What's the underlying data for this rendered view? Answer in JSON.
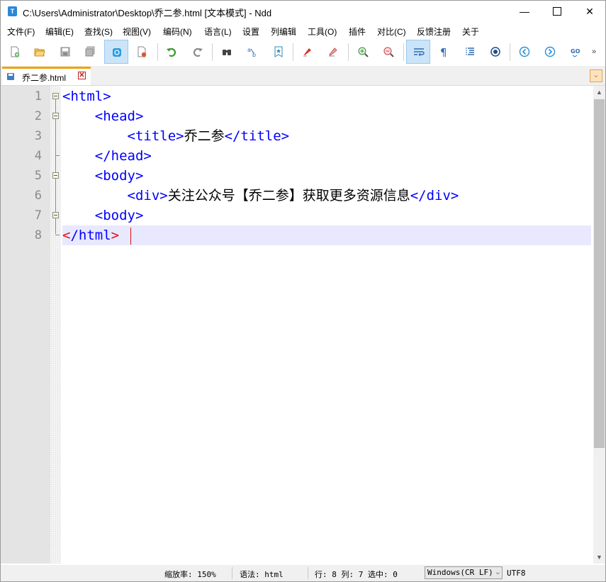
{
  "window": {
    "title": "C:\\Users\\Administrator\\Desktop\\乔二参.html [文本模式] - Ndd",
    "app_icon_letter": "T",
    "minimize": "—",
    "close": "✕"
  },
  "menu": [
    "文件(F)",
    "编辑(E)",
    "查找(S)",
    "视图(V)",
    "编码(N)",
    "语言(L)",
    "设置",
    "列编辑",
    "工具(O)",
    "插件",
    "对比(C)",
    "反馈注册",
    "关于"
  ],
  "toolbar": {
    "overflow": "»",
    "buttons": [
      "new-file-icon",
      "open-file-icon",
      "save-icon",
      "save-all-icon",
      "file-monitor-icon",
      "close-file-icon",
      "undo-icon",
      "redo-icon",
      "find-icon",
      "replace-icon",
      "bookmark-icon",
      "mark-icon",
      "clear-mark-icon",
      "zoom-in-icon",
      "zoom-out-icon",
      "word-wrap-icon",
      "show-symbols-icon",
      "indent-guide-icon",
      "macro-icon",
      "prev-icon",
      "next-icon",
      "goto-line-icon"
    ]
  },
  "tab": {
    "label": "乔二参.html",
    "close": "✕",
    "dropdown": "⌄"
  },
  "editor": {
    "line_numbers": [
      "1",
      "2",
      "3",
      "4",
      "5",
      "6",
      "7",
      "8"
    ],
    "lines": [
      {
        "indent": "",
        "parts": [
          [
            "tag",
            "<html>"
          ]
        ]
      },
      {
        "indent": "    ",
        "parts": [
          [
            "tag",
            "<head>"
          ]
        ]
      },
      {
        "indent": "        ",
        "parts": [
          [
            "tag",
            "<title>"
          ],
          [
            "txt",
            "乔二参"
          ],
          [
            "tag",
            "</title>"
          ]
        ]
      },
      {
        "indent": "    ",
        "parts": [
          [
            "tag",
            "</head>"
          ]
        ]
      },
      {
        "indent": "    ",
        "parts": [
          [
            "tag",
            "<body>"
          ]
        ]
      },
      {
        "indent": "        ",
        "parts": [
          [
            "tag",
            "<div>"
          ],
          [
            "txt",
            "关注公众号【乔二参】获取更多资源信息"
          ],
          [
            "tag",
            "</div>"
          ]
        ]
      },
      {
        "indent": "    ",
        "parts": [
          [
            "tag",
            "<body>"
          ]
        ]
      },
      {
        "indent": "",
        "parts": [
          [
            "tag-hl",
            "<"
          ],
          [
            "tag",
            "/html"
          ],
          [
            "tag-hl",
            ">"
          ]
        ]
      }
    ]
  },
  "status": {
    "zoom": "缩放率: 150%",
    "syntax": "语法: html",
    "position": "行: 8 列: 7 选中: 0",
    "eol": "Windows(CR LF)",
    "encoding": "UTF8"
  }
}
